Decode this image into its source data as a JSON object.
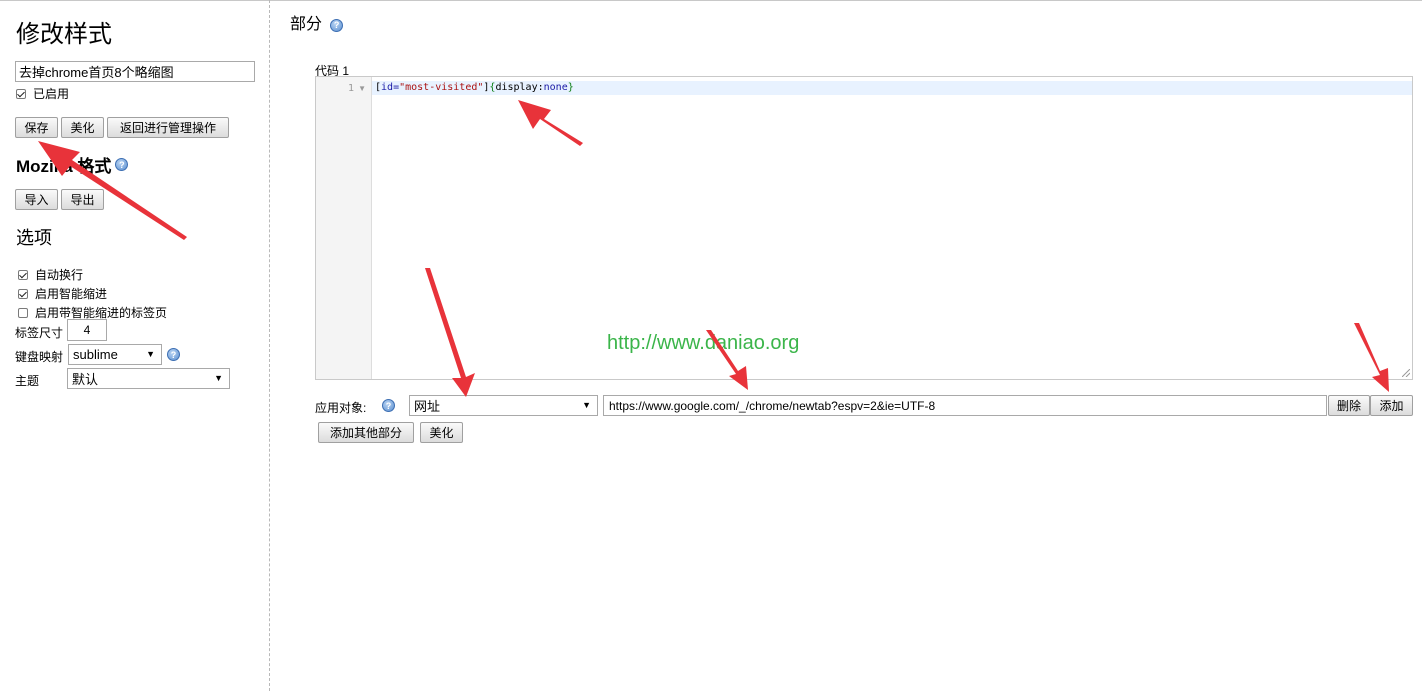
{
  "sidebar": {
    "title": "修改样式",
    "style_name_value": "去掉chrome首页8个略缩图",
    "enabled_label": "已启用",
    "enabled_checked": true,
    "buttons": {
      "save": "保存",
      "beautify": "美化",
      "back": "返回进行管理操作"
    },
    "mozilla_heading": "Mozilla 格式",
    "import_label": "导入",
    "export_label": "导出",
    "options_heading": "选项",
    "options": [
      {
        "label": "自动换行",
        "checked": true
      },
      {
        "label": "启用智能缩进",
        "checked": true
      },
      {
        "label": "启用带智能缩进的标签页",
        "checked": false
      }
    ],
    "tab_size_label": "标签尺寸",
    "tab_size_value": "4",
    "keymap_label": "键盘映射",
    "keymap_value": "sublime",
    "theme_label": "主题",
    "theme_value": "默认"
  },
  "main": {
    "section_title": "部分",
    "code_label": "代码 1",
    "editor": {
      "line_number": "1",
      "code": {
        "open_bracket": "[",
        "attr": "id=",
        "string": "\"most-visited\"",
        "close_bracket": "]",
        "open_brace": "{",
        "property": "display",
        "colon": ":",
        "value": "none",
        "close_brace": "}"
      }
    },
    "watermark": "http://www.daniao.org",
    "apply_to_label": "应用对象:",
    "apply_type_value": "网址",
    "apply_url_value": "https://www.google.com/_/chrome/newtab?espv=2&ie=UTF-8",
    "delete_label": "删除",
    "add_label": "添加",
    "add_section_label": "添加其他部分",
    "beautify_label": "美化"
  },
  "colors": {
    "accent_arrow": "#e8333a",
    "watermark": "#3bb54a",
    "help_icon": "#5b8fd0"
  }
}
